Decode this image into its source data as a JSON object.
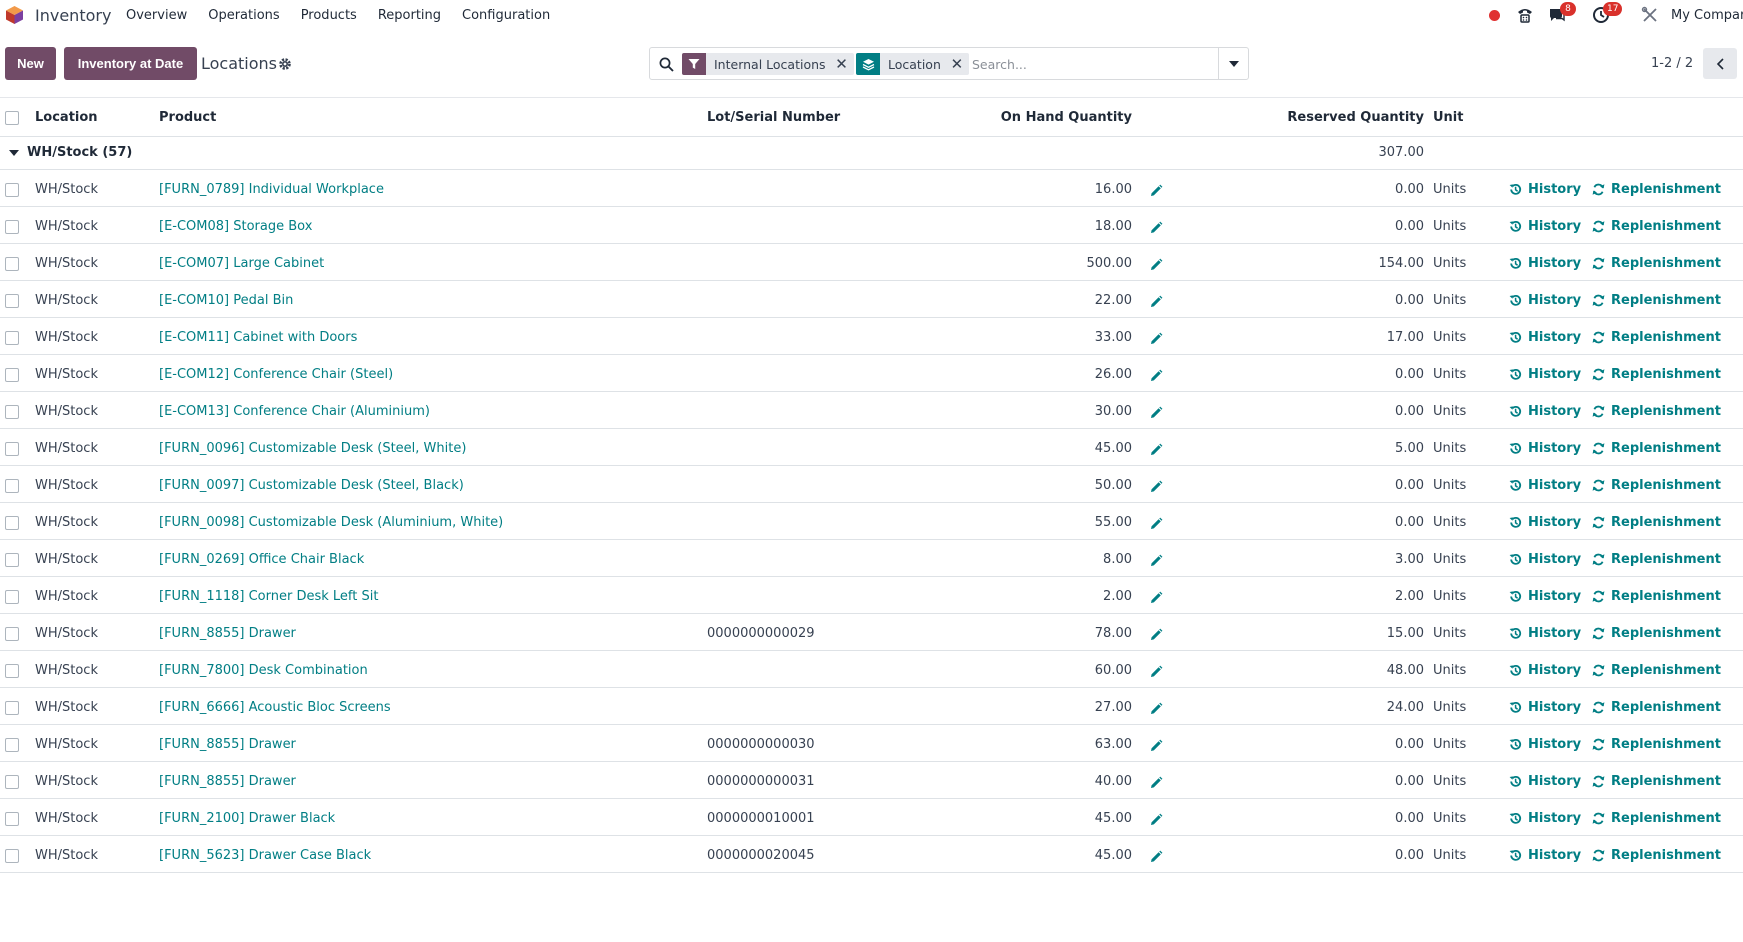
{
  "navbar": {
    "app_name": "Inventory",
    "menu": [
      "Overview",
      "Operations",
      "Products",
      "Reporting",
      "Configuration"
    ],
    "messages_badge": "8",
    "activities_badge": "17",
    "company": "My Compar"
  },
  "control": {
    "new_label": "New",
    "inventory_at_date_label": "Inventory at Date",
    "breadcrumb": "Locations",
    "facets": [
      {
        "label": "Internal Locations",
        "icon": "filter-icon",
        "color": "#714b67"
      },
      {
        "label": "Location",
        "icon": "layers-icon",
        "color": "#017e84"
      }
    ],
    "search_placeholder": "Search...",
    "pager": "1-2 / 2"
  },
  "table": {
    "headers": {
      "location": "Location",
      "product": "Product",
      "lot": "Lot/Serial Number",
      "on_hand": "On Hand Quantity",
      "reserved": "Reserved Quantity",
      "unit": "Unit"
    },
    "group": {
      "label": "WH/Stock (57)",
      "reserved_total": "307.00"
    },
    "history_label": "History",
    "replenishment_label": "Replenishment",
    "rows": [
      {
        "location": "WH/Stock",
        "product": "[FURN_0789] Individual Workplace",
        "lot": "",
        "on_hand": "16.00",
        "reserved": "0.00",
        "unit": "Units"
      },
      {
        "location": "WH/Stock",
        "product": "[E-COM08] Storage Box",
        "lot": "",
        "on_hand": "18.00",
        "reserved": "0.00",
        "unit": "Units"
      },
      {
        "location": "WH/Stock",
        "product": "[E-COM07] Large Cabinet",
        "lot": "",
        "on_hand": "500.00",
        "reserved": "154.00",
        "unit": "Units"
      },
      {
        "location": "WH/Stock",
        "product": "[E-COM10] Pedal Bin",
        "lot": "",
        "on_hand": "22.00",
        "reserved": "0.00",
        "unit": "Units"
      },
      {
        "location": "WH/Stock",
        "product": "[E-COM11] Cabinet with Doors",
        "lot": "",
        "on_hand": "33.00",
        "reserved": "17.00",
        "unit": "Units"
      },
      {
        "location": "WH/Stock",
        "product": "[E-COM12] Conference Chair (Steel)",
        "lot": "",
        "on_hand": "26.00",
        "reserved": "0.00",
        "unit": "Units"
      },
      {
        "location": "WH/Stock",
        "product": "[E-COM13] Conference Chair (Aluminium)",
        "lot": "",
        "on_hand": "30.00",
        "reserved": "0.00",
        "unit": "Units"
      },
      {
        "location": "WH/Stock",
        "product": "[FURN_0096] Customizable Desk (Steel, White)",
        "lot": "",
        "on_hand": "45.00",
        "reserved": "5.00",
        "unit": "Units"
      },
      {
        "location": "WH/Stock",
        "product": "[FURN_0097] Customizable Desk (Steel, Black)",
        "lot": "",
        "on_hand": "50.00",
        "reserved": "0.00",
        "unit": "Units"
      },
      {
        "location": "WH/Stock",
        "product": "[FURN_0098] Customizable Desk (Aluminium, White)",
        "lot": "",
        "on_hand": "55.00",
        "reserved": "0.00",
        "unit": "Units"
      },
      {
        "location": "WH/Stock",
        "product": "[FURN_0269] Office Chair Black",
        "lot": "",
        "on_hand": "8.00",
        "reserved": "3.00",
        "unit": "Units"
      },
      {
        "location": "WH/Stock",
        "product": "[FURN_1118] Corner Desk Left Sit",
        "lot": "",
        "on_hand": "2.00",
        "reserved": "2.00",
        "unit": "Units"
      },
      {
        "location": "WH/Stock",
        "product": "[FURN_8855] Drawer",
        "lot": "0000000000029",
        "on_hand": "78.00",
        "reserved": "15.00",
        "unit": "Units"
      },
      {
        "location": "WH/Stock",
        "product": "[FURN_7800] Desk Combination",
        "lot": "",
        "on_hand": "60.00",
        "reserved": "48.00",
        "unit": "Units"
      },
      {
        "location": "WH/Stock",
        "product": "[FURN_6666] Acoustic Bloc Screens",
        "lot": "",
        "on_hand": "27.00",
        "reserved": "24.00",
        "unit": "Units"
      },
      {
        "location": "WH/Stock",
        "product": "[FURN_8855] Drawer",
        "lot": "0000000000030",
        "on_hand": "63.00",
        "reserved": "0.00",
        "unit": "Units"
      },
      {
        "location": "WH/Stock",
        "product": "[FURN_8855] Drawer",
        "lot": "0000000000031",
        "on_hand": "40.00",
        "reserved": "0.00",
        "unit": "Units"
      },
      {
        "location": "WH/Stock",
        "product": "[FURN_2100] Drawer Black",
        "lot": "0000000010001",
        "on_hand": "45.00",
        "reserved": "0.00",
        "unit": "Units"
      },
      {
        "location": "WH/Stock",
        "product": "[FURN_5623] Drawer Case Black",
        "lot": "0000000020045",
        "on_hand": "45.00",
        "reserved": "0.00",
        "unit": "Units"
      }
    ]
  }
}
